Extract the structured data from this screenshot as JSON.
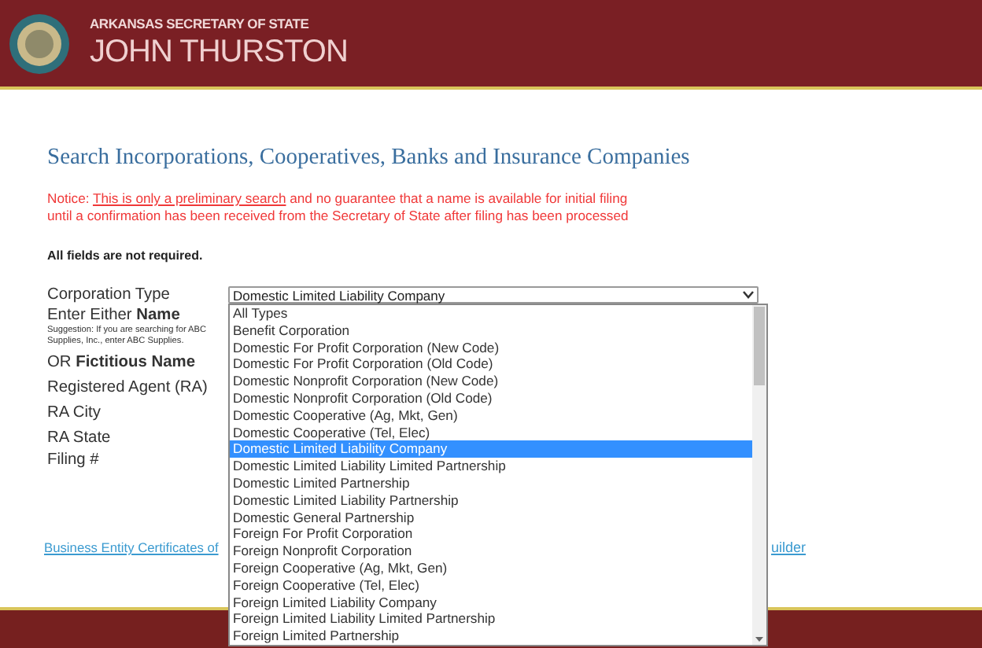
{
  "header": {
    "subtitle": "ARKANSAS SECRETARY OF STATE",
    "name": "JOHN THURSTON"
  },
  "title": "Search Incorporations, Cooperatives, Banks and Insurance Companies",
  "notice": {
    "prefix": "Notice:",
    "link": "This is only a preliminary search",
    "text": "and no guarantee that a name is available for initial filing until a confirmation has been received from the Secretary of State after filing has been processed"
  },
  "note": "All fields are not required.",
  "form": [
    {
      "label": "Corporation Type"
    },
    {
      "label": "Enter Either **Name**",
      "hint": "Suggestion: If you are searching for ABC Supplies, Inc., enter ABC Supplies."
    },
    {
      "label": "OR **Fictitious Name**"
    },
    {
      "label": "Registered Agent (RA)"
    },
    {
      "label": "RA City"
    },
    {
      "label": "RA State"
    },
    {
      "label": "Filing #"
    }
  ],
  "select": {
    "value": "Domestic Limited Liability Company",
    "expanded": true,
    "options": [
      {
        "label": "All Types",
        "selected": false
      },
      {
        "label": "Benefit Corporation",
        "selected": false
      },
      {
        "label": "Domestic For Profit Corporation (New Code)",
        "selected": false
      },
      {
        "label": "Domestic For Profit Corporation (Old Code)",
        "selected": false
      },
      {
        "label": "Domestic Nonprofit Corporation (New Code)",
        "selected": false
      },
      {
        "label": "Domestic Nonprofit Corporation (Old Code)",
        "selected": false
      },
      {
        "label": "Domestic Cooperative (Ag, Mkt, Gen)",
        "selected": false
      },
      {
        "label": "Domestic Cooperative (Tel, Elec)",
        "selected": false
      },
      {
        "label": "Domestic Limited Liability Company",
        "selected": true
      },
      {
        "label": "Domestic Limited Liability Limited Partnership",
        "selected": false
      },
      {
        "label": "Domestic Limited Partnership",
        "selected": false
      },
      {
        "label": "Domestic Limited Liability Partnership",
        "selected": false
      },
      {
        "label": "Domestic General Partnership",
        "selected": false
      },
      {
        "label": "Foreign For Profit Corporation",
        "selected": false
      },
      {
        "label": "Foreign Nonprofit Corporation",
        "selected": false
      },
      {
        "label": "Foreign Cooperative (Ag, Mkt, Gen)",
        "selected": false
      },
      {
        "label": "Foreign Cooperative (Tel, Elec)",
        "selected": false
      },
      {
        "label": "Foreign Limited Liability Company",
        "selected": false
      },
      {
        "label": "Foreign Limited Liability Limited Partnership",
        "selected": false
      },
      {
        "label": "Foreign Limited Partnership",
        "selected": false
      }
    ]
  },
  "links": [
    "Business Entity Certificates of",
    "uilder"
  ]
}
